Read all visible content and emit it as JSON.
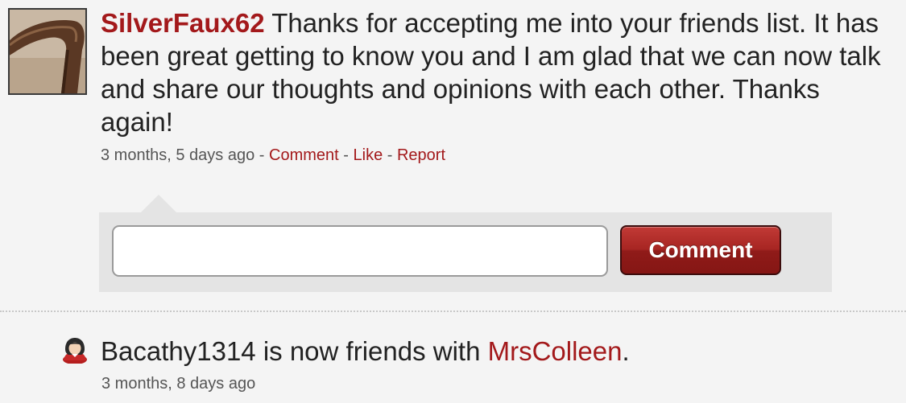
{
  "post": {
    "author": "SilverFaux62",
    "message": " Thanks for accepting me into your friends list. It has been great getting to know you and I am glad that we can now talk and share our thoughts and opinions with each other. Thanks again!",
    "timestamp": "3 months, 5 days ago",
    "separator": " - ",
    "actions": {
      "comment": "Comment",
      "like": "Like",
      "report": "Report"
    }
  },
  "comment_form": {
    "input_value": "",
    "input_placeholder": "",
    "button_label": "Comment"
  },
  "activity": {
    "icon": "user-icon",
    "actor": "Bacathy1314",
    "action_text": " is now friends with ",
    "friend": "MrsColleen",
    "trailing": ".",
    "timestamp": "3 months, 8 days ago"
  },
  "colors": {
    "accent": "#a3191b",
    "background": "#f4f4f4",
    "comment_box": "#e4e4e4"
  }
}
